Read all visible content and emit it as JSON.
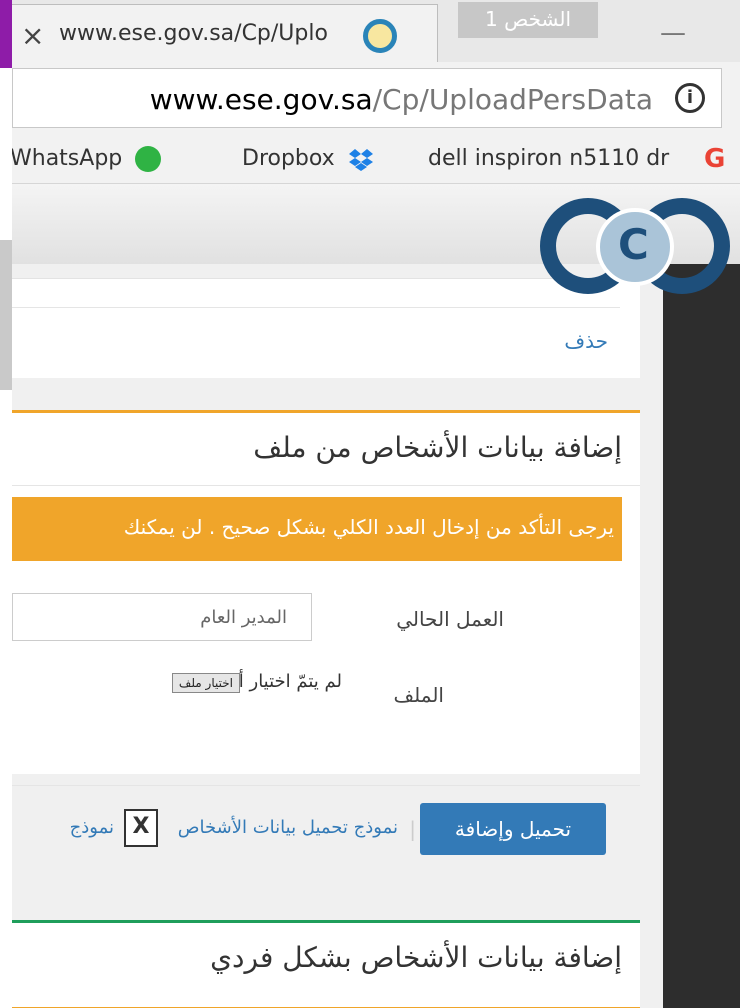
{
  "browser": {
    "tab_close": "×",
    "tab_title": "www.ese.gov.sa/Cp/Uplo",
    "profile": "الشخص 1",
    "minimize": "—",
    "url_domain": "www.ese.gov.sa",
    "url_path": "/Cp/UploadPersData",
    "info": "i",
    "bookmarks": [
      {
        "label": "WhatsApp",
        "icon": "whatsapp-icon"
      },
      {
        "label": "Dropbox",
        "icon": "dropbox-icon"
      },
      {
        "label": "dell inspiron n5110 dr",
        "icon": "google-icon"
      }
    ],
    "google_letter": "G"
  },
  "section1": {
    "delete_link": "حذف"
  },
  "section2": {
    "title": "إضافة بيانات الأشخاص من ملف",
    "alert": "يرجى التأكد من إدخال العدد الكلي بشكل صحيح . لن يمكنك",
    "work_label": "العمل الحالي",
    "work_value": "المدير العام",
    "file_label": "الملف",
    "file_button": "اختيار ملف",
    "file_status": "لم يتمّ اختيار أيّ ملف",
    "upload_button": "تحميل وإضافة",
    "separator": "|",
    "template_link": "نموذج تحميل بيانات الأشخاص",
    "template_link_2": "نموذج",
    "excel_letter": "X"
  },
  "section3": {
    "title": "إضافة بيانات الأشخاص بشكل فردي"
  },
  "colors": {
    "accent_orange": "#f0a52a",
    "primary_blue": "#337ab7",
    "accent_green": "#1f9e5b",
    "profile_purple": "#8e1ca8"
  }
}
